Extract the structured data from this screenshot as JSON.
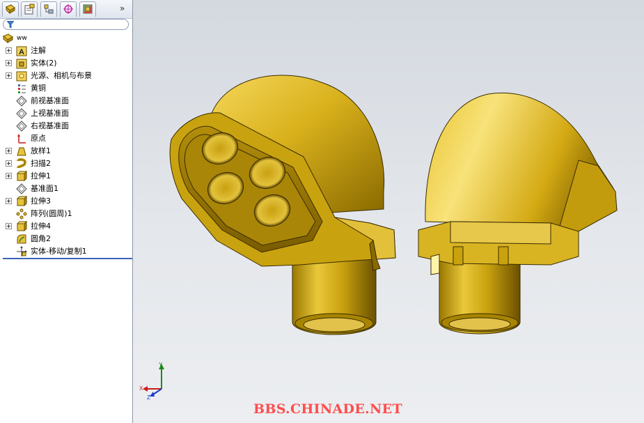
{
  "panel": {
    "tabs": [
      {
        "name": "feature-manager-tab-icon"
      },
      {
        "name": "property-manager-tab-icon"
      },
      {
        "name": "configuration-manager-tab-icon"
      },
      {
        "name": "dimxpert-manager-tab-icon"
      },
      {
        "name": "display-manager-tab-icon"
      }
    ],
    "more_label": "»",
    "root_label": "ww",
    "items": [
      {
        "label": "注解",
        "icon": "annotation-icon",
        "expandable": true
      },
      {
        "label": "实体(2)",
        "icon": "solid-bodies-icon",
        "expandable": true
      },
      {
        "label": "光源、相机与布景",
        "icon": "lights-cameras-icon",
        "expandable": true
      },
      {
        "label": "黄铜",
        "icon": "material-icon",
        "expandable": false
      },
      {
        "label": "前视基准面",
        "icon": "plane-icon",
        "expandable": false
      },
      {
        "label": "上视基准面",
        "icon": "plane-icon",
        "expandable": false
      },
      {
        "label": "右视基准面",
        "icon": "plane-icon",
        "expandable": false
      },
      {
        "label": "原点",
        "icon": "origin-icon",
        "expandable": false
      },
      {
        "label": "放样1",
        "icon": "loft-icon",
        "expandable": true
      },
      {
        "label": "扫描2",
        "icon": "sweep-icon",
        "expandable": true
      },
      {
        "label": "拉伸1",
        "icon": "extrude-icon",
        "expandable": true
      },
      {
        "label": "基准面1",
        "icon": "plane-icon",
        "expandable": false
      },
      {
        "label": "拉伸3",
        "icon": "extrude-icon",
        "expandable": true
      },
      {
        "label": "阵列(圆周)1",
        "icon": "circular-pattern-icon",
        "expandable": false
      },
      {
        "label": "拉伸4",
        "icon": "extrude-icon",
        "expandable": true
      },
      {
        "label": "圆角2",
        "icon": "fillet-icon",
        "expandable": false
      },
      {
        "label": "实体-移动/复制1",
        "icon": "move-copy-body-icon",
        "expandable": false
      }
    ]
  },
  "viewport": {
    "triad": {
      "x_label": "X",
      "y_label": "Y",
      "z_label": "Z"
    },
    "watermark": "BBS.CHINADE.NET"
  },
  "colors": {
    "brass": "#c9a10f",
    "brass_light": "#f2d35a",
    "brass_dark": "#7a5c00",
    "accent": "#3b63b5"
  }
}
